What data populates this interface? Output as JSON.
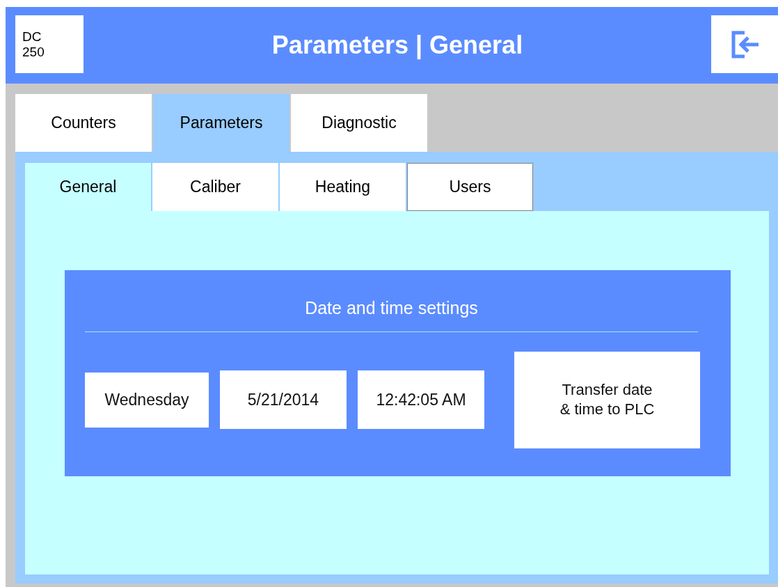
{
  "header": {
    "device_label": "DC\n250",
    "title": "Parameters | General"
  },
  "tabs": [
    {
      "label": "Counters",
      "selected": false
    },
    {
      "label": "Parameters",
      "selected": true
    },
    {
      "label": "Diagnostic",
      "selected": false
    }
  ],
  "subtabs": [
    {
      "label": "General",
      "selected": true,
      "focused": false
    },
    {
      "label": "Caliber",
      "selected": false,
      "focused": false
    },
    {
      "label": "Heating",
      "selected": false,
      "focused": false
    },
    {
      "label": "Users",
      "selected": false,
      "focused": true
    }
  ],
  "date_time_panel": {
    "title": "Date and time settings",
    "fields": [
      {
        "value": "Wednesday"
      },
      {
        "value": "5/21/2014"
      },
      {
        "value": "12:42:05 AM"
      }
    ],
    "button": "Transfer date\n& time to PLC"
  }
}
